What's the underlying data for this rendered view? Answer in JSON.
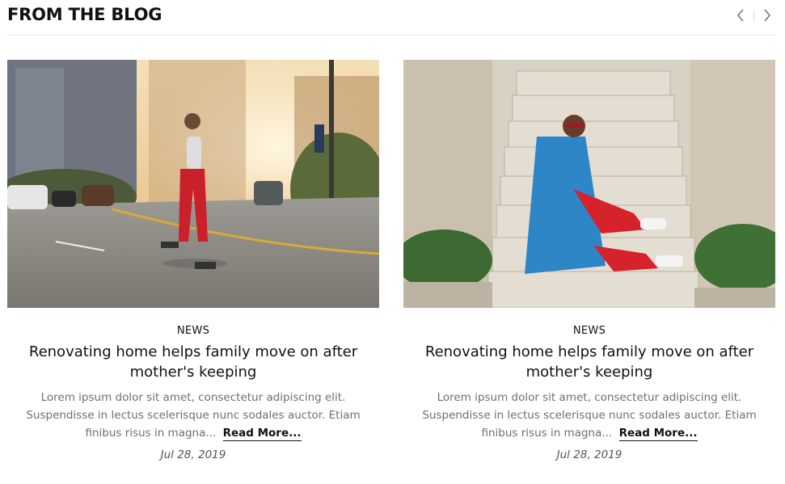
{
  "section": {
    "title": "FROM THE BLOG"
  },
  "nav": {
    "prev_icon": "chevron-left-icon",
    "next_icon": "chevron-right-icon"
  },
  "posts": [
    {
      "category": "NEWS",
      "title": "Renovating home helps family move on after mother's keeping",
      "excerpt": "Lorem ipsum dolor sit amet, consectetur adipiscing elit. Suspendisse in lectus scelerisque nunc sodales auctor. Etiam finibus risus in magna...",
      "read_more": "Read More...",
      "date": "Jul 28, 2019"
    },
    {
      "category": "NEWS",
      "title": "Renovating home helps family move on after mother's keeping",
      "excerpt": "Lorem ipsum dolor sit amet, consectetur adipiscing elit. Suspendisse in lectus scelerisque nunc sodales auctor. Etiam finibus risus in magna...",
      "read_more": "Read More...",
      "date": "Jul 28, 2019"
    }
  ],
  "colors": {
    "text": "#111111",
    "muted": "#6f6f6f",
    "divider": "#e6e6e6"
  }
}
